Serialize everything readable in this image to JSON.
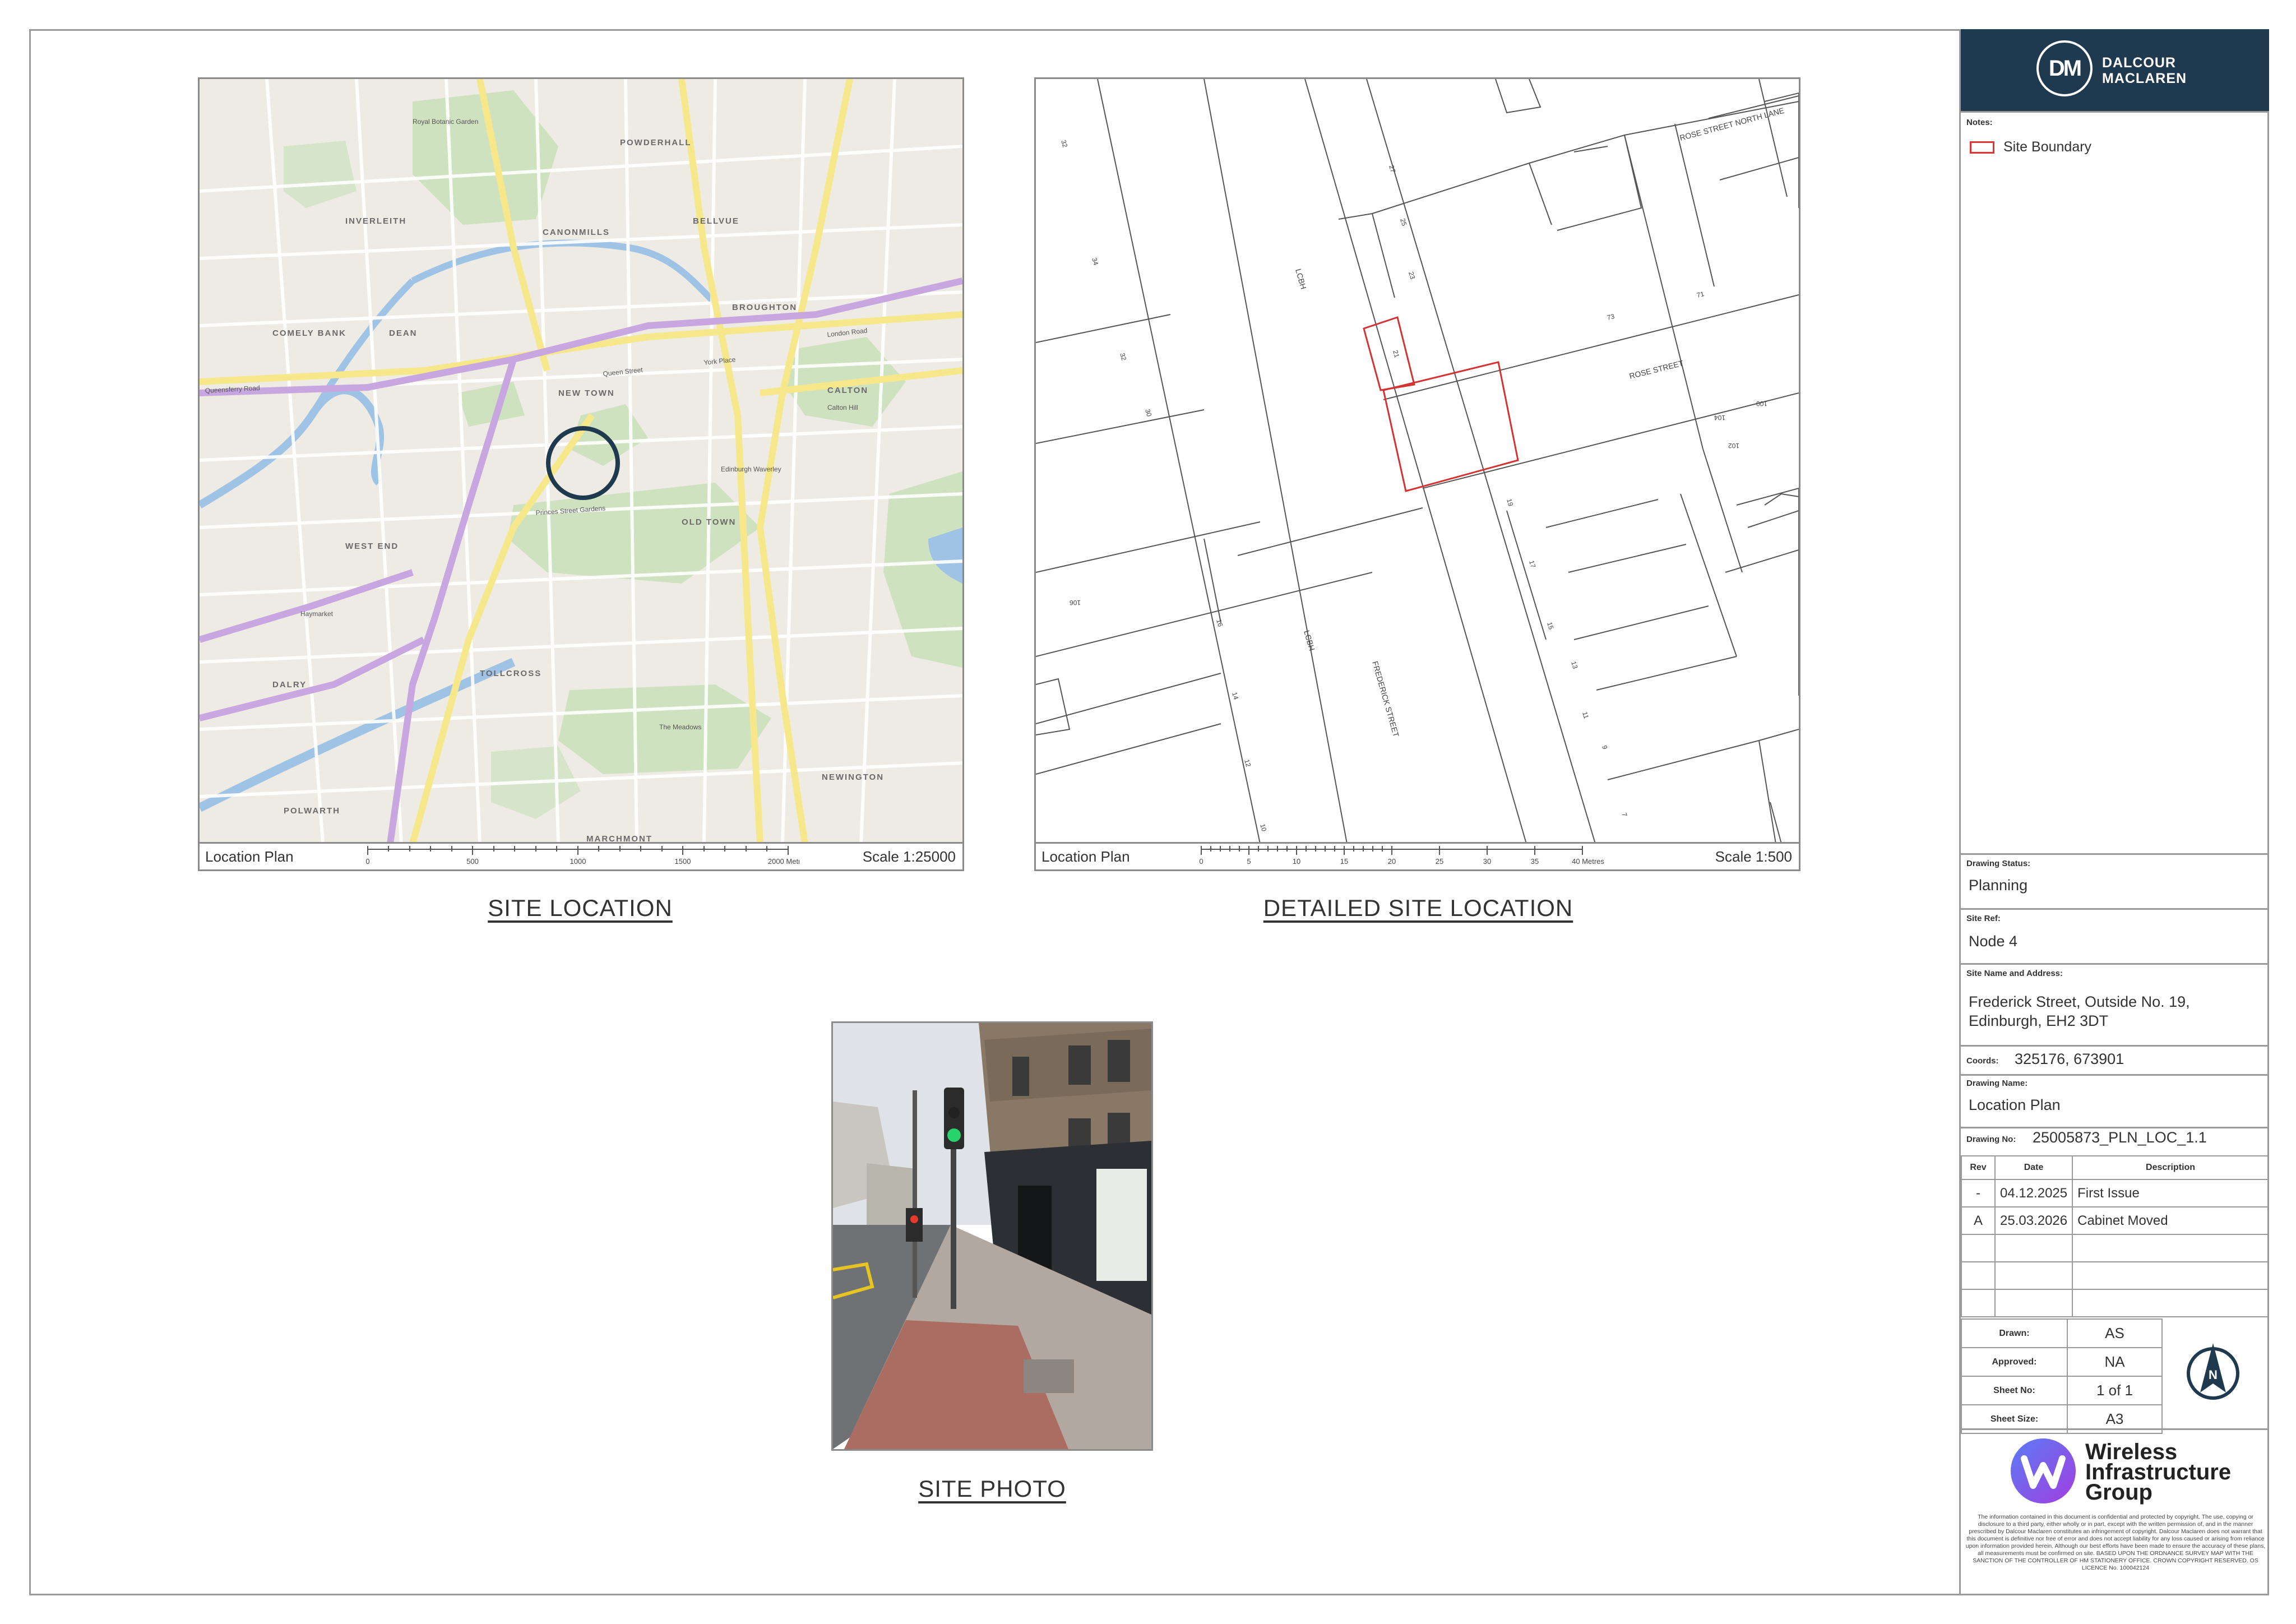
{
  "colors": {
    "brand_header": "#1f3a4f",
    "site_boundary": "#d33333",
    "wig_purple": "#7a4ef0"
  },
  "site_location": {
    "title": "SITE LOCATION",
    "footer_label": "Location Plan",
    "scale": "Scale 1:25000",
    "scalebar_ticks": [
      "0",
      "500",
      "1000",
      "1500",
      "2000 Metres"
    ],
    "map_labels": [
      "POWDERHALL",
      "INVERLEITH",
      "CANONMILLS",
      "BELLVUE",
      "COMELY BANK",
      "DEAN",
      "BROUGHTON",
      "NEW TOWN",
      "CALTON",
      "WEST END",
      "OLD TOWN",
      "DALRY",
      "TOLLCROSS",
      "MARCHMONT",
      "POLWARTH",
      "NEWINGTON",
      "Queen Street",
      "York Place",
      "London Road",
      "Princes Street Gardens",
      "The Meadows",
      "Edinburgh Waverley",
      "Haymarket",
      "Queensferry Road",
      "Royal Botanic Garden",
      "Calton Hill"
    ]
  },
  "detailed_location": {
    "title": "DETAILED SITE LOCATION",
    "footer_label": "Location Plan",
    "scale": "Scale 1:500",
    "scalebar_ticks": [
      "0",
      "5",
      "10",
      "15",
      "20",
      "25",
      "30",
      "35",
      "40 Metres"
    ],
    "street_labels": [
      "ROSE STREET NORTH LANE",
      "ROSE STREET",
      "FREDERICK STREET"
    ],
    "lcbh_labels": [
      "LCBH",
      "LCBH"
    ],
    "plot_numbers": [
      "32",
      "34",
      "32",
      "30",
      "27",
      "25",
      "23",
      "21",
      "73",
      "71",
      "19",
      "17",
      "15",
      "13",
      "11",
      "9",
      "7",
      "100",
      "104",
      "102",
      "106",
      "16",
      "14",
      "12",
      "10"
    ]
  },
  "site_photo": {
    "title": "SITE PHOTO"
  },
  "title_block": {
    "company_line1": "DALCOUR",
    "company_line2": "MACLAREN",
    "logo_letters": "DM",
    "notes_label": "Notes:",
    "legend_site_boundary": "Site Boundary",
    "drawing_status_label": "Drawing Status:",
    "drawing_status": "Planning",
    "site_ref_label": "Site Ref:",
    "site_ref": "Node 4",
    "site_name_label": "Site Name and Address:",
    "site_address_line1": "Frederick Street, Outside No. 19,",
    "site_address_line2": "Edinburgh, EH2 3DT",
    "coords_label": "Coords:",
    "coords": "325176, 673901",
    "drawing_name_label": "Drawing Name:",
    "drawing_name": "Location Plan",
    "drawing_no_label": "Drawing No:",
    "drawing_no": "25005873_PLN_LOC_1.1",
    "rev_headers": [
      "Rev",
      "Date",
      "Description"
    ],
    "revisions": [
      {
        "rev": "-",
        "date": "04.12.2025",
        "desc": "First Issue"
      },
      {
        "rev": "A",
        "date": "25.03.2026",
        "desc": "Cabinet Moved"
      }
    ],
    "drawn_label": "Drawn:",
    "drawn": "AS",
    "approved_label": "Approved:",
    "approved": "NA",
    "sheet_no_label": "Sheet No:",
    "sheet_no": "1 of 1",
    "sheet_size_label": "Sheet Size:",
    "sheet_size": "A3",
    "north_letter": "N",
    "wig_line1": "Wireless",
    "wig_line2": "Infrastructure",
    "wig_line3": "Group",
    "disclaimer": "The information contained in this document is confidential and protected by copyright. The use, copying or disclosure to a third party, either wholly or in part, except with the written permission of, and in the manner prescribed by Dalcour Maclaren constitutes an infringement of copyright. Dalcour Maclaren does not warrant that this document is definitive nor free of error and does not accept liability for any loss caused or arising from reliance upon information provided herein. Although our best efforts have been made to ensure the accuracy of these plans, all measurements must be confirmed on site. BASED UPON THE ORDNANCE SURVEY MAP WITH THE SANCTION OF THE CONTROLLER OF HM STATIONERY OFFICE. CROWN COPYRIGHT RESERVED. OS LICENCE No. 100042124"
  }
}
